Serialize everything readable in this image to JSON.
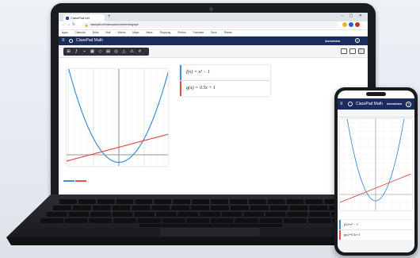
{
  "browser": {
    "tab_title": "ClassPad.net",
    "url": "classpad.net/classpad/worksheets/graph",
    "bookmarks": [
      "Apps",
      "Calendar",
      "Drive",
      "Mail",
      "Videos",
      "Maps",
      "News",
      "Shopping",
      "Photos",
      "Translate",
      "Docs",
      "Sheets"
    ]
  },
  "app": {
    "title": "ClassPad Math",
    "login_label": "Anmelden",
    "help_label": "?"
  },
  "expressions": [
    {
      "label": "f(x) = x² − 1",
      "color": "#3d8fd8"
    },
    {
      "label": "g(x) = 0.5x + 1",
      "color": "#e0524a"
    }
  ],
  "phone": {
    "title": "ClassPad Math",
    "login_label": "Anmelden",
    "help_label": "?",
    "expressions": [
      {
        "label": "f(x)=x² − 1",
        "color": "#3d8fd8"
      },
      {
        "label": "g(x)=0.5x+1",
        "color": "#e0524a"
      }
    ]
  },
  "colors": {
    "header_bg": "#1a2b5e",
    "curve_blue": "#3d8fd8",
    "line_red": "#e0524a"
  }
}
